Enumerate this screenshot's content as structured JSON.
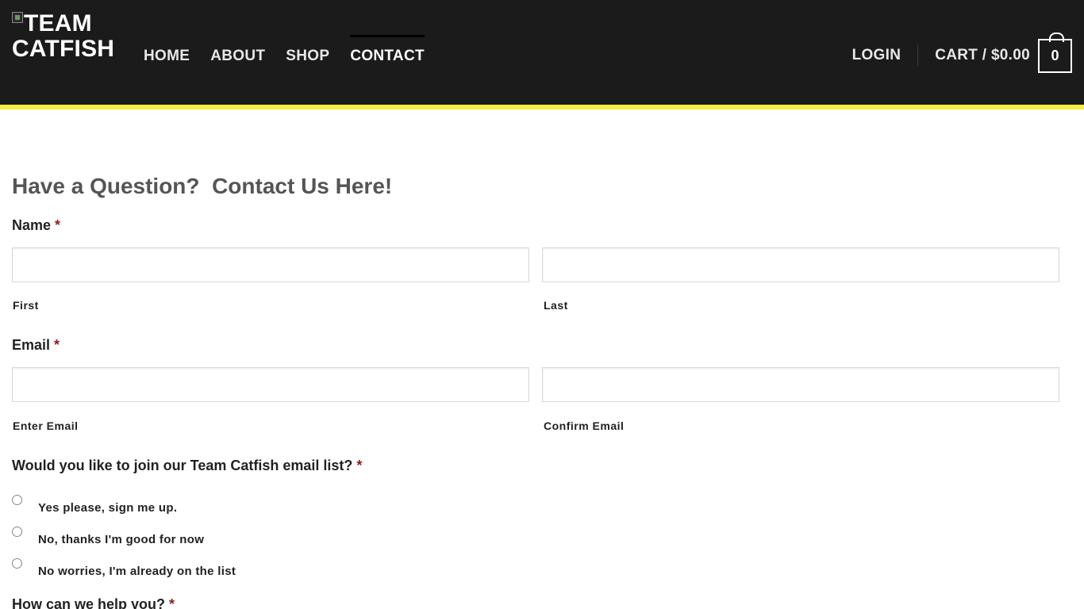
{
  "site": {
    "logo_text": "Team Catfish"
  },
  "nav": {
    "items": [
      {
        "label": "HOME"
      },
      {
        "label": "ABOUT"
      },
      {
        "label": "SHOP"
      },
      {
        "label": "CONTACT"
      }
    ],
    "active": "CONTACT",
    "login_label": "LOGIN",
    "cart_label": "CART / $0.00",
    "cart_count": "0"
  },
  "colors": {
    "header_bg": "#1b1b1b",
    "accent_stripe": "#f5ef3e",
    "required_mark": "#8b1f1f",
    "title_text": "#555555"
  },
  "form": {
    "title": "Have a Question?  Contact Us Here!",
    "required_mark": "*",
    "name": {
      "label": "Name",
      "first_sublabel": "First",
      "last_sublabel": "Last",
      "first_value": "",
      "last_value": ""
    },
    "email": {
      "label": "Email",
      "enter_sublabel": "Enter Email",
      "confirm_sublabel": "Confirm Email",
      "enter_value": "",
      "confirm_value": ""
    },
    "email_list": {
      "label": "Would you like to join our Team Catfish email list?",
      "options": [
        {
          "label": "Yes please, sign me up."
        },
        {
          "label": "No, thanks I'm good for now"
        },
        {
          "label": "No worries, I'm already on the list"
        }
      ]
    },
    "help": {
      "label": "How can we help you?"
    }
  }
}
